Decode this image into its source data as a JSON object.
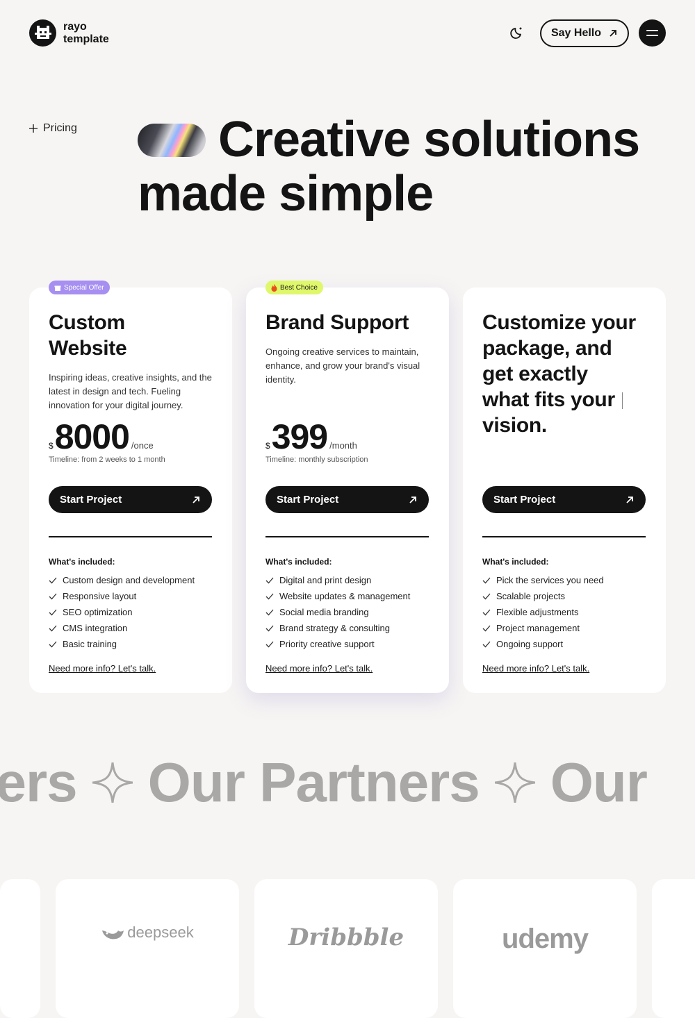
{
  "header": {
    "logo_line1": "rayo",
    "logo_line2": "template",
    "say_hello": "Say Hello"
  },
  "hero": {
    "eyebrow": "Pricing",
    "title_line1": "Creative solutions",
    "title_line2": "made simple"
  },
  "plans": [
    {
      "badge": "Special Offer",
      "title_line1": "Custom",
      "title_line2": "Website",
      "description": "Inspiring ideas, creative insights, and the latest in design and tech. Fueling innovation for your digital journey.",
      "currency": "$",
      "amount": "8000",
      "period": "/once",
      "timeline": "Timeline: from 2 weeks to 1 month",
      "cta": "Start Project",
      "included_title": "What's included:",
      "features": [
        "Custom design and development",
        "Responsive layout",
        "SEO optimization",
        "CMS integration",
        "Basic training"
      ],
      "link": "Need more info? Let's talk."
    },
    {
      "badge": "Best Choice",
      "title_line1": "Brand Support",
      "description": "Ongoing creative services to maintain, enhance, and grow your brand's visual identity.",
      "currency": "$",
      "amount": "399",
      "period": "/month",
      "timeline": "Timeline: monthly subscription",
      "cta": "Start Project",
      "included_title": "What's included:",
      "features": [
        "Digital and print design",
        "Website updates & management",
        "Social media branding",
        "Brand strategy & consulting",
        "Priority creative support"
      ],
      "link": "Need more info? Let's talk."
    },
    {
      "title_line1": "Customize your",
      "title_line2": "package, and",
      "title_line3": "get exactly",
      "title_line4": "what fits your",
      "title_line5": "vision.",
      "cta": "Start Project",
      "included_title": "What's included:",
      "features": [
        "Pick the services you need",
        "Scalable projects",
        "Flexible adjustments",
        "Project management",
        "Ongoing support"
      ],
      "link": "Need more info? Let's talk."
    }
  ],
  "marquee": {
    "seg1": "tners",
    "seg2": "Our Partners",
    "seg3": "Our"
  },
  "partners": [
    "deepseek",
    "Dribbble",
    "udemy"
  ],
  "colors": {
    "background": "#f6f5f3",
    "ink": "#141414",
    "badge_purple": "#a68ff0",
    "badge_lime": "#dff76a",
    "marquee_gray": "#a9a8a6"
  },
  "icons": [
    "moon-icon",
    "arrow-up-right-icon",
    "menu-icon",
    "sparkle-icon",
    "check-icon"
  ]
}
